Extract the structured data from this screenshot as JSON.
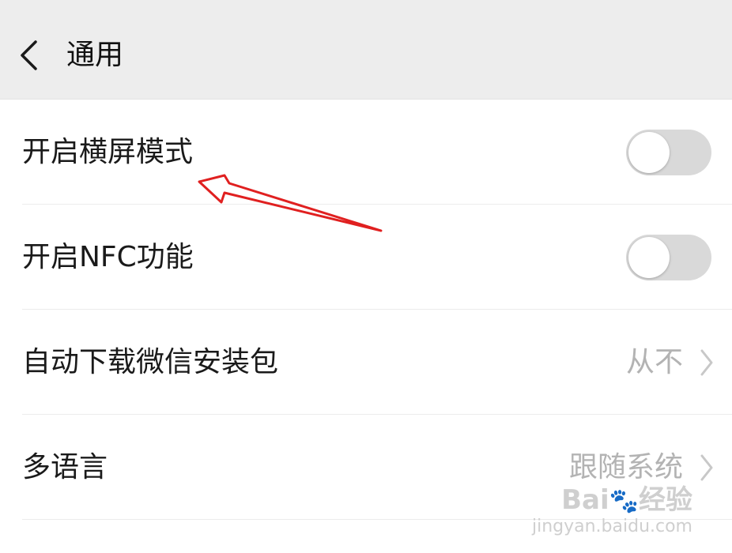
{
  "header": {
    "title": "通用",
    "back_icon": "chevron-left-icon"
  },
  "settings": [
    {
      "label": "开启横屏模式",
      "type": "toggle",
      "enabled": false
    },
    {
      "label": "开启NFC功能",
      "type": "toggle",
      "enabled": false
    },
    {
      "label": "自动下载微信安装包",
      "type": "select",
      "value": "从不"
    },
    {
      "label": "多语言",
      "type": "select",
      "value": "跟随系统"
    }
  ],
  "colors": {
    "header_bg": "#ededed",
    "toggle_off": "#d9d9d9",
    "annotation_arrow": "#e02020",
    "value_text": "#b3b3b3"
  },
  "watermark": {
    "logo_text": "Bai",
    "logo_paw": "🐾",
    "logo_suffix": "经验",
    "url": "jingyan.baidu.com"
  }
}
